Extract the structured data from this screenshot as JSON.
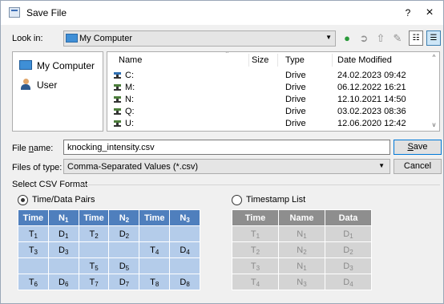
{
  "window": {
    "title": "Save File",
    "help": "?",
    "close": "×"
  },
  "lookin": {
    "label": "Look in:",
    "value": "My Computer"
  },
  "sidebar": {
    "items": [
      {
        "label": "My Computer"
      },
      {
        "label": "User"
      }
    ]
  },
  "filelist": {
    "columns": [
      "Name",
      "Size",
      "Type",
      "Date Modified"
    ],
    "rows": [
      {
        "name": "C:",
        "size": "",
        "type": "Drive",
        "modified": "24.02.2023 09:42"
      },
      {
        "name": "M:",
        "size": "",
        "type": "Drive",
        "modified": "06.12.2022 16:21"
      },
      {
        "name": "N:",
        "size": "",
        "type": "Drive",
        "modified": "12.10.2021 14:50"
      },
      {
        "name": "Q:",
        "size": "",
        "type": "Drive",
        "modified": "03.02.2023 08:36"
      },
      {
        "name": "U:",
        "size": "",
        "type": "Drive",
        "modified": "12.06.2020 12:42"
      }
    ]
  },
  "filename": {
    "label_prefix": "File ",
    "label_key": "n",
    "label_suffix": "ame:",
    "value": "knocking_intensity.csv"
  },
  "filetype": {
    "label": "Files of type:",
    "value": "Comma-Separated Values (*.csv)"
  },
  "buttons": {
    "save_key": "S",
    "save_rest": "ave",
    "cancel": "Cancel"
  },
  "csv_format": {
    "title": "Select CSV Format",
    "option_pairs": "Time/Data Pairs",
    "option_timestamp": "Timestamp List",
    "selected": "Time/Data Pairs"
  },
  "pairs_table": {
    "header": [
      [
        "Time",
        ""
      ],
      [
        "N",
        "1"
      ],
      [
        "Time",
        ""
      ],
      [
        "N",
        "2"
      ],
      [
        "Time",
        ""
      ],
      [
        "N",
        "3"
      ]
    ],
    "rows": [
      [
        [
          "T",
          "1"
        ],
        [
          "D",
          "1"
        ],
        [
          "T",
          "2"
        ],
        [
          "D",
          "2"
        ],
        [
          "",
          ""
        ],
        [
          "",
          ""
        ]
      ],
      [
        [
          "T",
          "3"
        ],
        [
          "D",
          "3"
        ],
        [
          "",
          ""
        ],
        [
          "",
          ""
        ],
        [
          "T",
          "4"
        ],
        [
          "D",
          "4"
        ]
      ],
      [
        [
          "",
          ""
        ],
        [
          "",
          ""
        ],
        [
          "T",
          "5"
        ],
        [
          "D",
          "5"
        ],
        [
          "",
          ""
        ],
        [
          "",
          ""
        ]
      ],
      [
        [
          "T",
          "6"
        ],
        [
          "D",
          "6"
        ],
        [
          "T",
          "7"
        ],
        [
          "D",
          "7"
        ],
        [
          "T",
          "8"
        ],
        [
          "D",
          "8"
        ]
      ]
    ]
  },
  "timestamp_table": {
    "header": [
      "Time",
      "Name",
      "Data"
    ],
    "rows": [
      [
        [
          "T",
          "1"
        ],
        [
          "N",
          "1"
        ],
        [
          "D",
          "1"
        ]
      ],
      [
        [
          "T",
          "2"
        ],
        [
          "N",
          "2"
        ],
        [
          "D",
          "2"
        ]
      ],
      [
        [
          "T",
          "3"
        ],
        [
          "N",
          "1"
        ],
        [
          "D",
          "3"
        ]
      ],
      [
        [
          "T",
          "4"
        ],
        [
          "N",
          "3"
        ],
        [
          "D",
          "4"
        ]
      ]
    ]
  },
  "colors": {
    "pairs_header": "#4f7fbd",
    "pairs_cell": "#b4ccea",
    "ts_header": "#8e8e8e",
    "ts_cell": "#d4d4d4",
    "accent": "#0078d7"
  },
  "icons": [
    "save-file-icon",
    "computer-icon",
    "user-icon",
    "drive-icon",
    "back-icon",
    "forward-icon",
    "up-folder-icon",
    "new-folder-icon",
    "list-view-icon",
    "details-view-icon"
  ]
}
